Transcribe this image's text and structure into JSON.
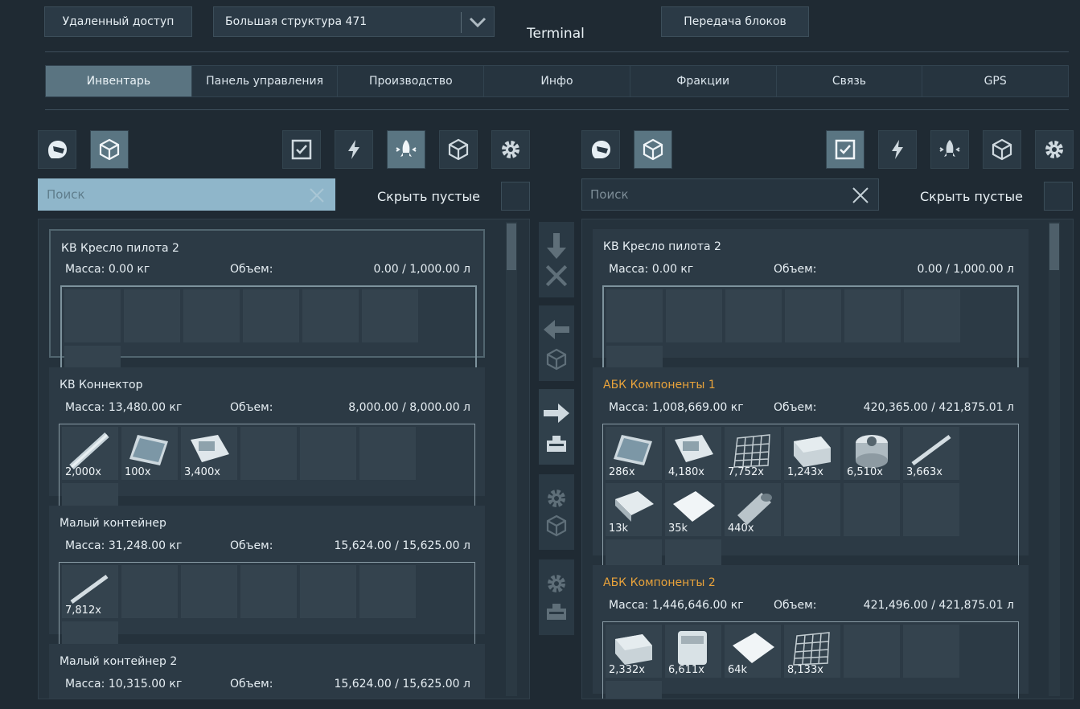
{
  "header": {
    "remote_access": "Удаленный доступ",
    "grid_select": "Большая структура 471",
    "title": "Terminal",
    "transfer": "Передача блоков"
  },
  "tabs": [
    {
      "label": "Инвентарь",
      "active": true
    },
    {
      "label": "Панель управления"
    },
    {
      "label": "Производство"
    },
    {
      "label": "Инфо"
    },
    {
      "label": "Фракции"
    },
    {
      "label": "Связь"
    },
    {
      "label": "GPS"
    }
  ],
  "left": {
    "search_placeholder": "Поиск",
    "hide_empty": "Скрыть пустые",
    "mass_label": "Масса:",
    "volume_label": "Объем:",
    "cards": [
      {
        "title": "КВ Кресло пилота 2",
        "mass": "0.00 кг",
        "volume": "0.00 / 1,000.00 л",
        "items": []
      },
      {
        "title": "КВ Коннектор",
        "mass": "13,480.00 кг",
        "volume": "8,000.00 / 8,000.00 л",
        "items": [
          "2,000x",
          "100x",
          "3,400x"
        ]
      },
      {
        "title": "Малый контейнер",
        "mass": "31,248.00 кг",
        "volume": "15,624.00 / 15,625.00 л",
        "items": [
          "7,812x"
        ]
      },
      {
        "title": "Малый контейнер 2",
        "mass": "10,315.00 кг",
        "volume": "15,624.00 / 15,625.00 л",
        "items": []
      }
    ]
  },
  "right": {
    "search_placeholder": "Поиск",
    "hide_empty": "Скрыть пустые",
    "mass_label": "Масса:",
    "volume_label": "Объем:",
    "cards": [
      {
        "title": "КВ Кресло пилота 2",
        "mass": "0.00 кг",
        "volume": "0.00 / 1,000.00 л",
        "items": []
      },
      {
        "title": "АБК Компоненты 1",
        "mass": "1,008,669.00 кг",
        "volume": "420,365.00 / 421,875.01 л",
        "items": [
          "286x",
          "4,180x",
          "7,752x",
          "1,243x",
          "6,510x",
          "3,663x",
          "13k",
          "35k",
          "440x"
        ]
      },
      {
        "title": "АБК Компоненты 2",
        "mass": "1,446,646.00 кг",
        "volume": "421,496.00 / 421,875.01 л",
        "items": [
          "2,332x",
          "6,611x",
          "64k",
          "8,133x"
        ]
      }
    ]
  },
  "colors": {
    "accent": "#5a7481",
    "orange": "#e9a33b",
    "search_focus": "#8fb6ca"
  }
}
